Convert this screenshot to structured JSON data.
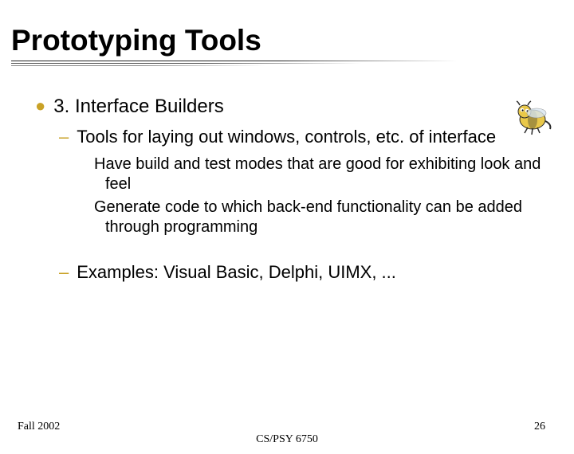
{
  "title": "Prototyping Tools",
  "bullet1": "3. Interface Builders",
  "sub1": "Tools for laying out windows, controls, etc. of interface",
  "detail1": "Have build and test modes that are good for exhibiting look and feel",
  "detail2": "Generate code to which back-end functionality can be added through programming",
  "sub2": "Examples: Visual Basic, Delphi, UIMX, ...",
  "footer": {
    "left": "Fall 2002",
    "center": "CS/PSY 6750",
    "right": "26"
  }
}
